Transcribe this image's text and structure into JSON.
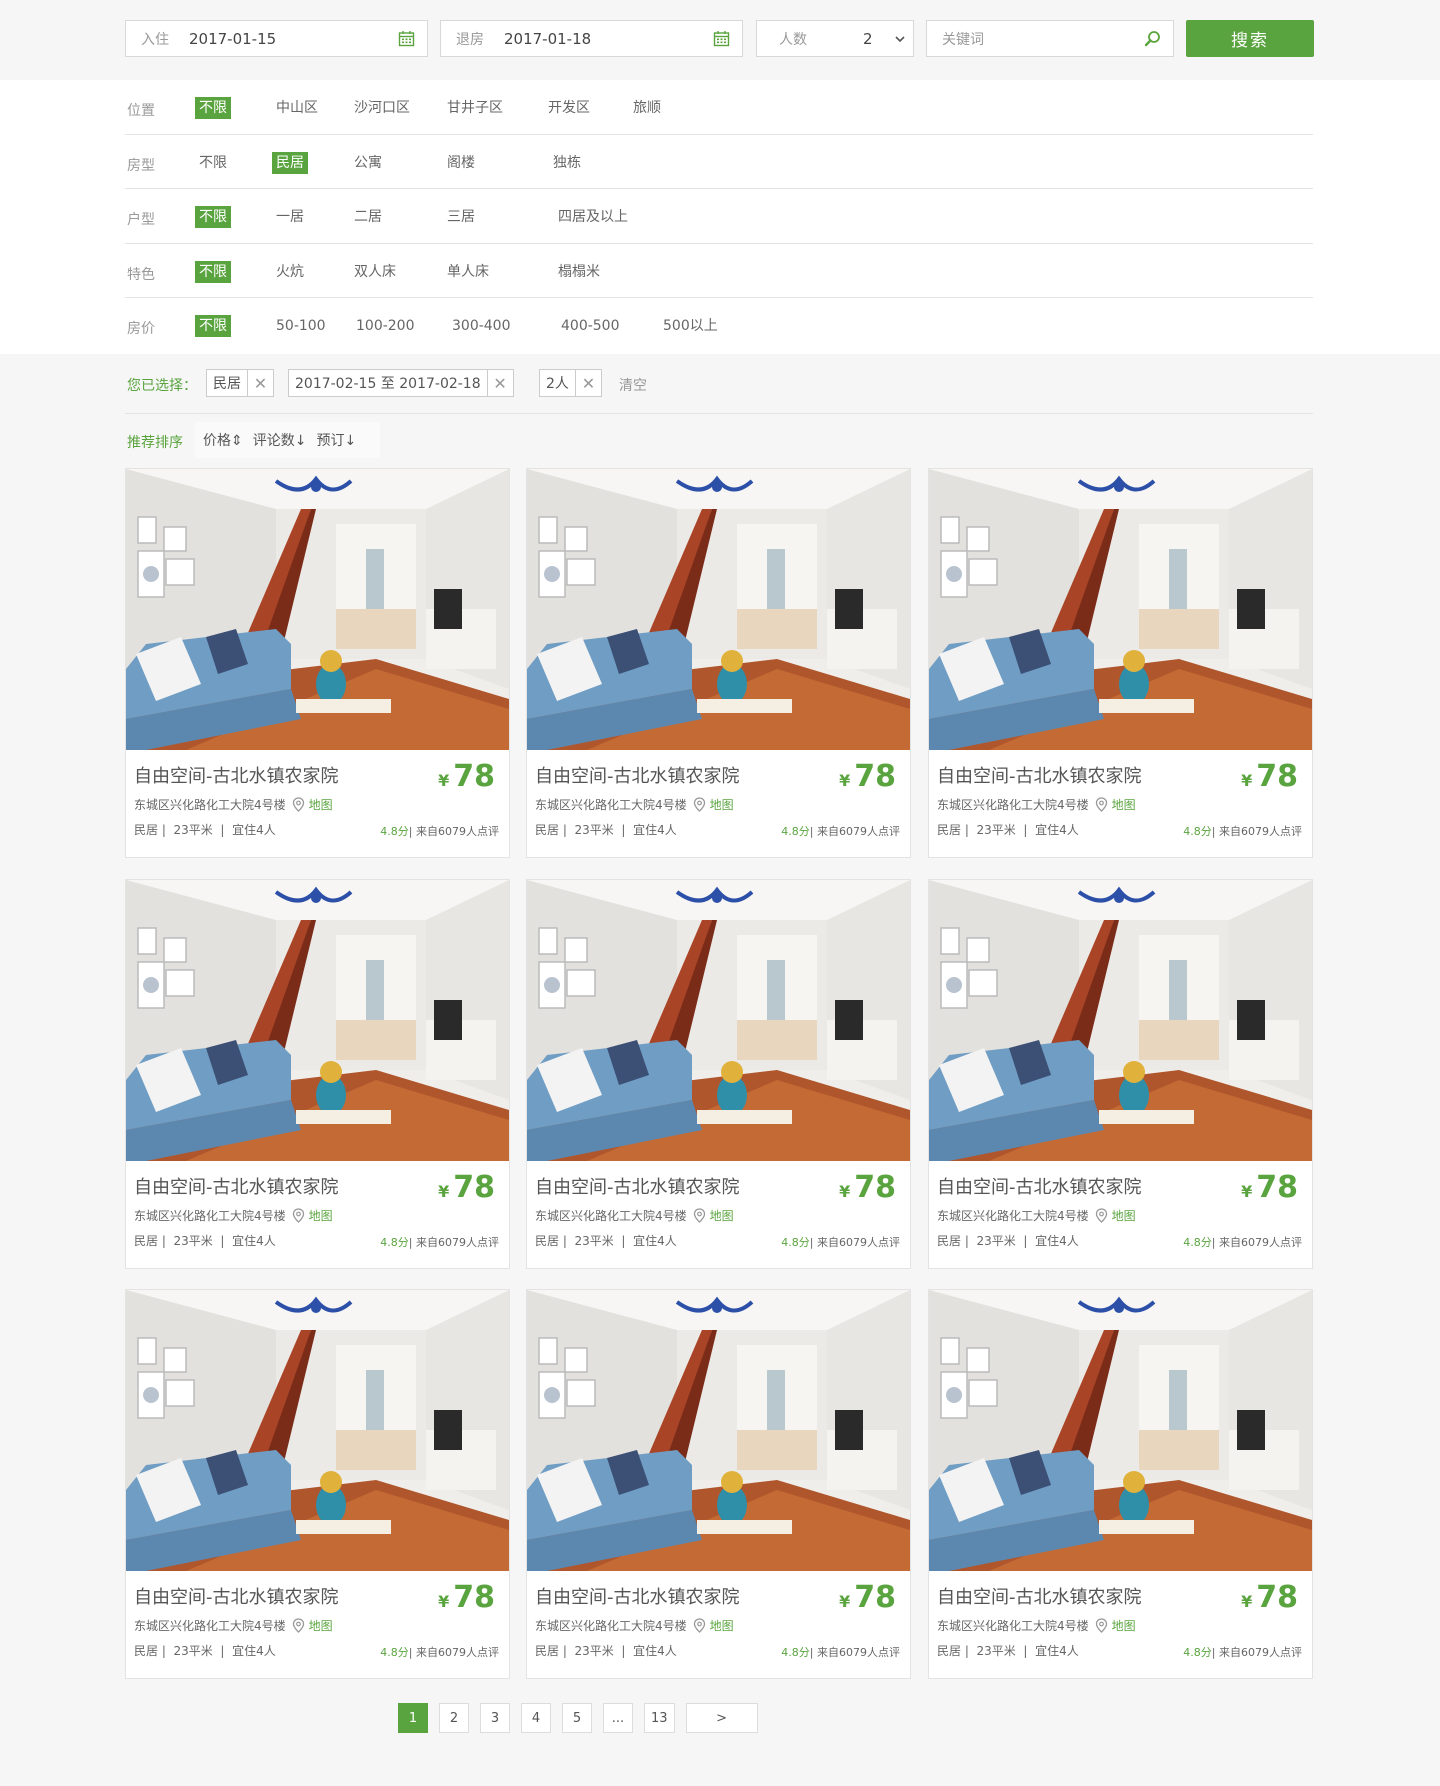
{
  "search": {
    "checkin_label": "入住",
    "checkin_value": "2017-01-15",
    "checkout_label": "退房",
    "checkout_value": "2017-01-18",
    "guests_label": "人数",
    "guests_value": "2",
    "keyword_placeholder": "关键词",
    "button": "搜索"
  },
  "filters": [
    {
      "label": "位置",
      "options": [
        "不限",
        "中山区",
        "沙河口区",
        "甘井子区",
        "开发区",
        "旅顺"
      ],
      "active": 0
    },
    {
      "label": "房型",
      "options": [
        "不限",
        "民居",
        "公寓",
        "阁楼",
        "独栋"
      ],
      "active": 1
    },
    {
      "label": "户型",
      "options": [
        "不限",
        "一居",
        "二居",
        "三居",
        "四居及以上"
      ],
      "active": 0
    },
    {
      "label": "特色",
      "options": [
        "不限",
        "火炕",
        "双人床",
        "单人床",
        "榻榻米"
      ],
      "active": 0
    },
    {
      "label": "房价",
      "options": [
        "不限",
        "50-100",
        "100-200",
        "300-400",
        "400-500",
        "500以上"
      ],
      "active": 0
    }
  ],
  "selected": {
    "label": "您已选择：",
    "tags": [
      "民居",
      "2017-02-15 至 2017-02-18",
      "2人"
    ],
    "clear": "清空"
  },
  "sort": {
    "main": "推荐排序",
    "options": [
      "价格",
      "评论数",
      "预订"
    ]
  },
  "listing": {
    "title": "自由空间-古北水镇农家院",
    "currency": "¥",
    "price": "78",
    "address": "东城区兴化路化工大院4号楼",
    "map": "地图",
    "type": "民居",
    "area": "23平米",
    "capacity": "宜住4人",
    "score": "4.8分",
    "reviews": "来自6079人点评"
  },
  "pagination": [
    "1",
    "2",
    "3",
    "4",
    "5",
    "...",
    "13",
    ">"
  ],
  "colors": {
    "accent": "#5aa43f"
  }
}
